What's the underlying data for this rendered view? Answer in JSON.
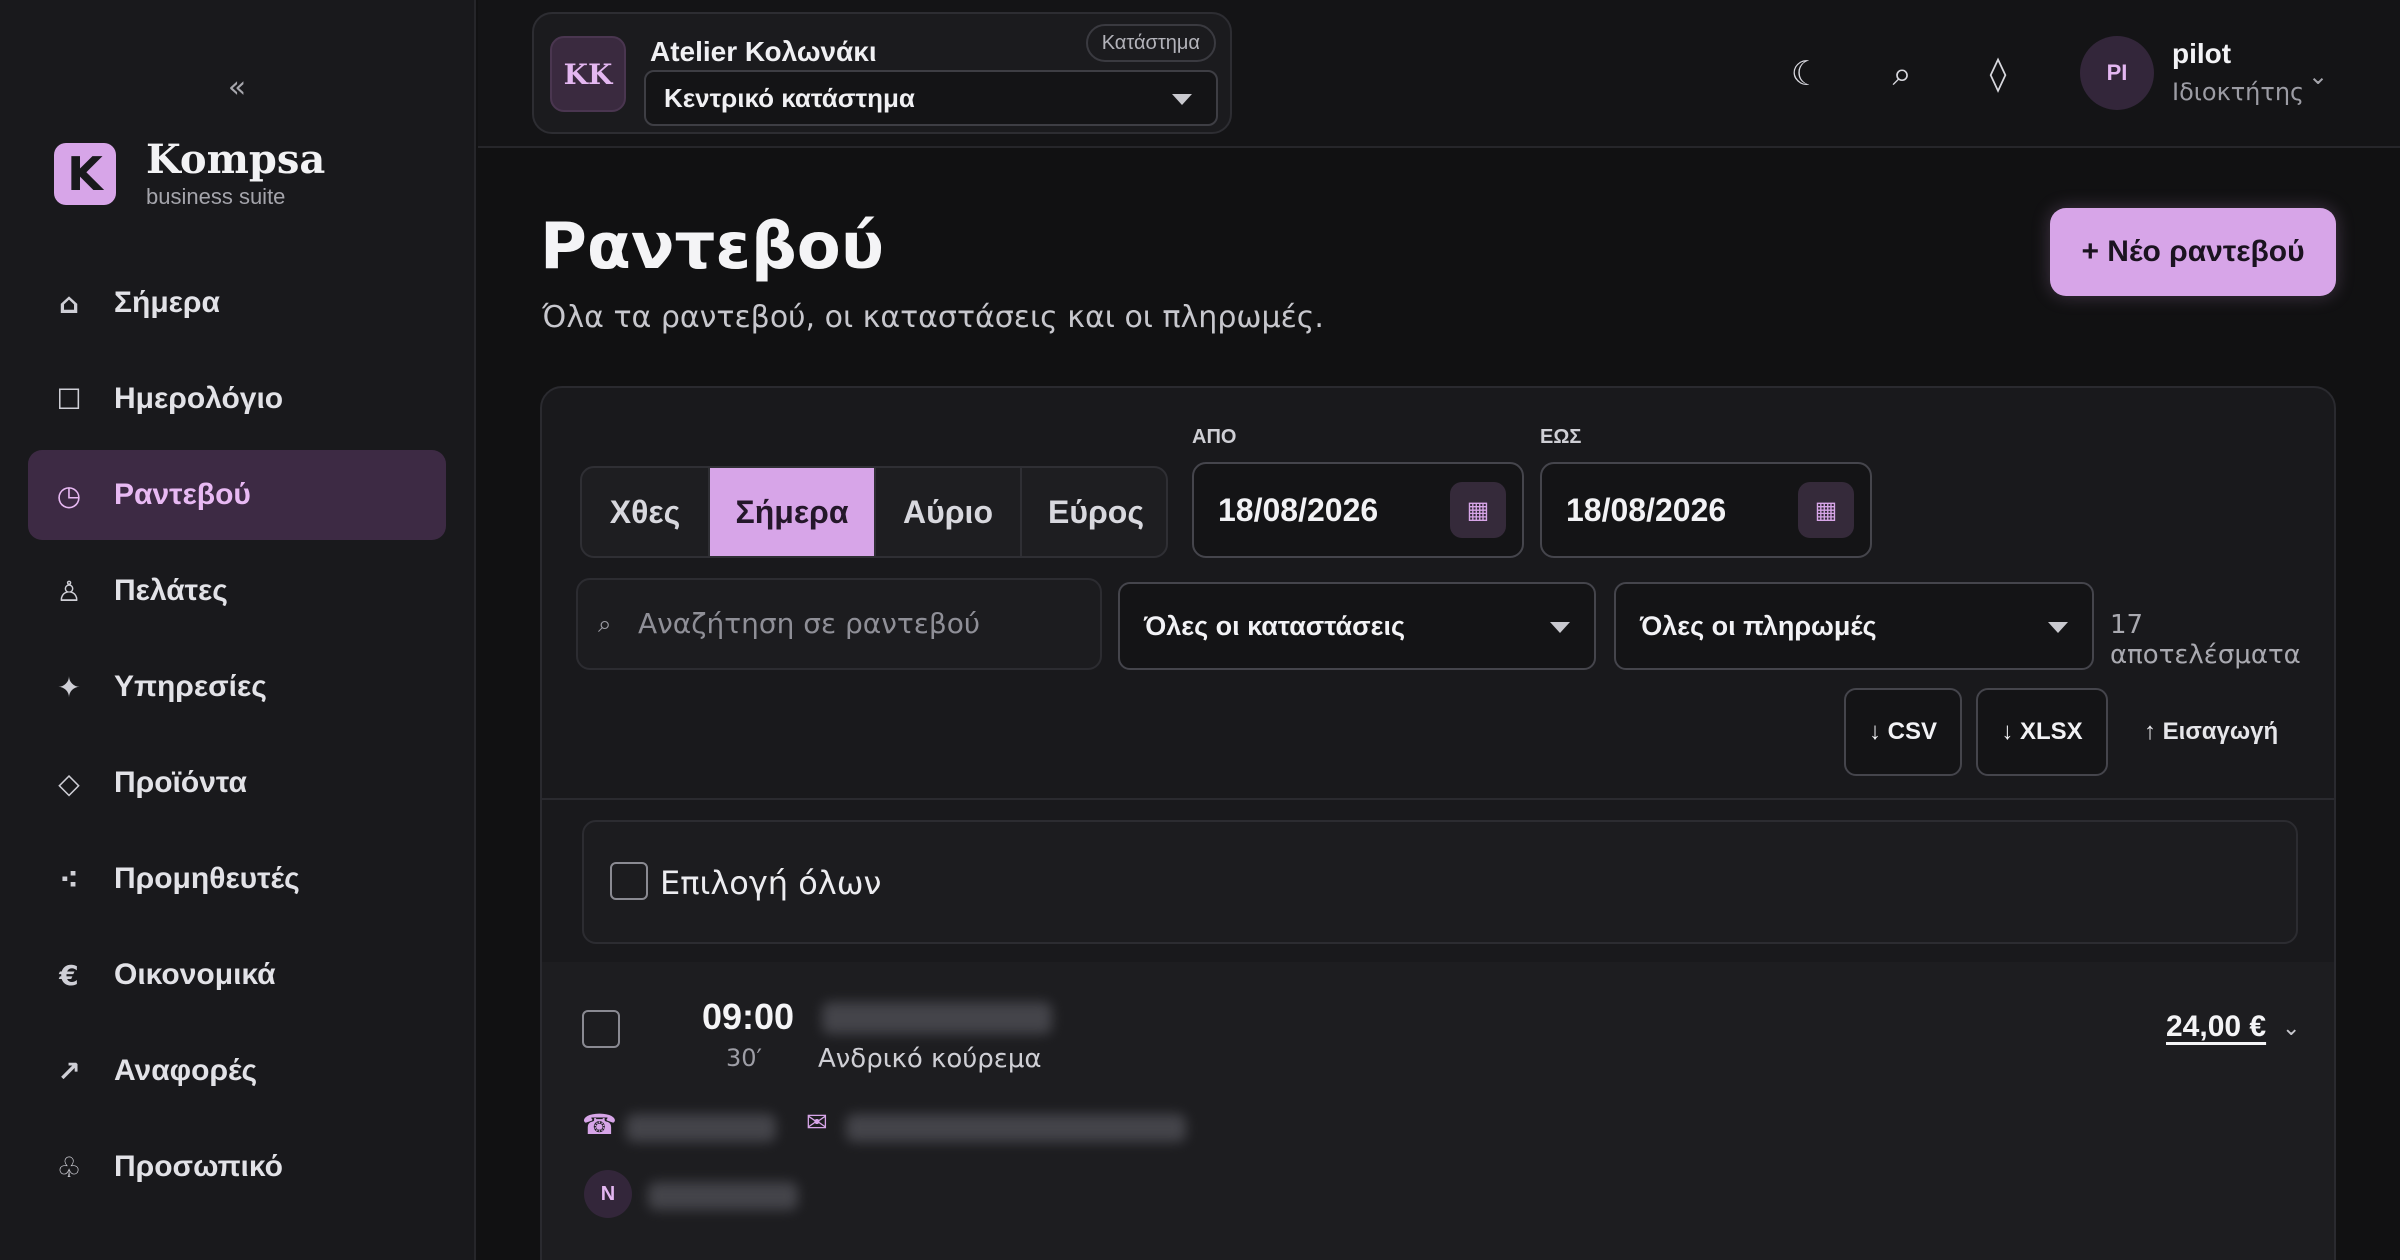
{
  "sidebar": {
    "collapse": "«",
    "brand": {
      "logo_letter": "K",
      "name": "Kompsa",
      "subtitle": "business suite"
    },
    "items": [
      {
        "label": "Σήμερα",
        "icon": "⌂",
        "icon_name": "home-icon"
      },
      {
        "label": "Ημερολόγιο",
        "icon": "☐",
        "icon_name": "calendar-icon"
      },
      {
        "label": "Ραντεβού",
        "icon": "◷",
        "icon_name": "clock-icon",
        "active": true
      },
      {
        "label": "Πελάτες",
        "icon": "♙",
        "icon_name": "user-icon"
      },
      {
        "label": "Υπηρεσίες",
        "icon": "✦",
        "icon_name": "sparkle-icon"
      },
      {
        "label": "Προϊόντα",
        "icon": "◇",
        "icon_name": "diamond-icon"
      },
      {
        "label": "Προμηθευτές",
        "icon": "⁖",
        "icon_name": "dots-icon"
      },
      {
        "label": "Οικονομικά",
        "icon": "€",
        "icon_name": "euro-icon"
      },
      {
        "label": "Αναφορές",
        "icon": "↗",
        "icon_name": "trend-icon"
      },
      {
        "label": "Προσωπικό",
        "icon": "♧",
        "icon_name": "staff-icon"
      }
    ]
  },
  "topbar": {
    "store": {
      "initials": "KK",
      "name": "Atelier Κολωνάκι",
      "badge": "Κατάστημα",
      "selected_branch": "Κεντρικό κατάστημα"
    },
    "icons": {
      "theme": "☾",
      "search": "⌕",
      "diamond": "◊"
    },
    "user": {
      "initials": "PI",
      "name": "pilot",
      "role": "Ιδιοκτήτης",
      "chevron": "⌄"
    }
  },
  "page": {
    "title": "Ραντεβού",
    "subtitle": "Όλα τα ραντεβού, οι καταστάσεις και οι πληρωμές.",
    "new_button": "+ Νέο ραντεβού"
  },
  "filters": {
    "tabs": [
      "Χθες",
      "Σήμερα",
      "Αύριο",
      "Εύρος"
    ],
    "active_tab": "Σήμερα",
    "from_label": "ΑΠΟ",
    "from_value": "18/08/2026",
    "to_label": "ΕΩΣ",
    "to_value": "18/08/2026",
    "calendar_icon": "▦",
    "search_icon": "⌕",
    "search_placeholder": "Αναζήτηση σε ραντεβού",
    "status_filter": "Όλες οι καταστάσεις",
    "payment_filter": "Όλες οι πληρωμές",
    "results": "17 αποτελέσματα",
    "export_csv": "↓ CSV",
    "export_xlsx": "↓ XLSX",
    "import": "↑ Εισαγωγή"
  },
  "list": {
    "select_all": "Επιλογή όλων",
    "appointments": [
      {
        "time": "09:00",
        "duration": "30′",
        "service": "Ανδρικό κούρεμα",
        "price": "24,00 €",
        "price_chevron": "⌄",
        "phone_icon": "☎",
        "mail_icon": "✉",
        "staff_initial": "N"
      }
    ]
  },
  "colors": {
    "accent": "#d7a5e8",
    "active_nav_bg": "#3d2a44",
    "background": "#111112",
    "sidebar": "#19191c"
  }
}
